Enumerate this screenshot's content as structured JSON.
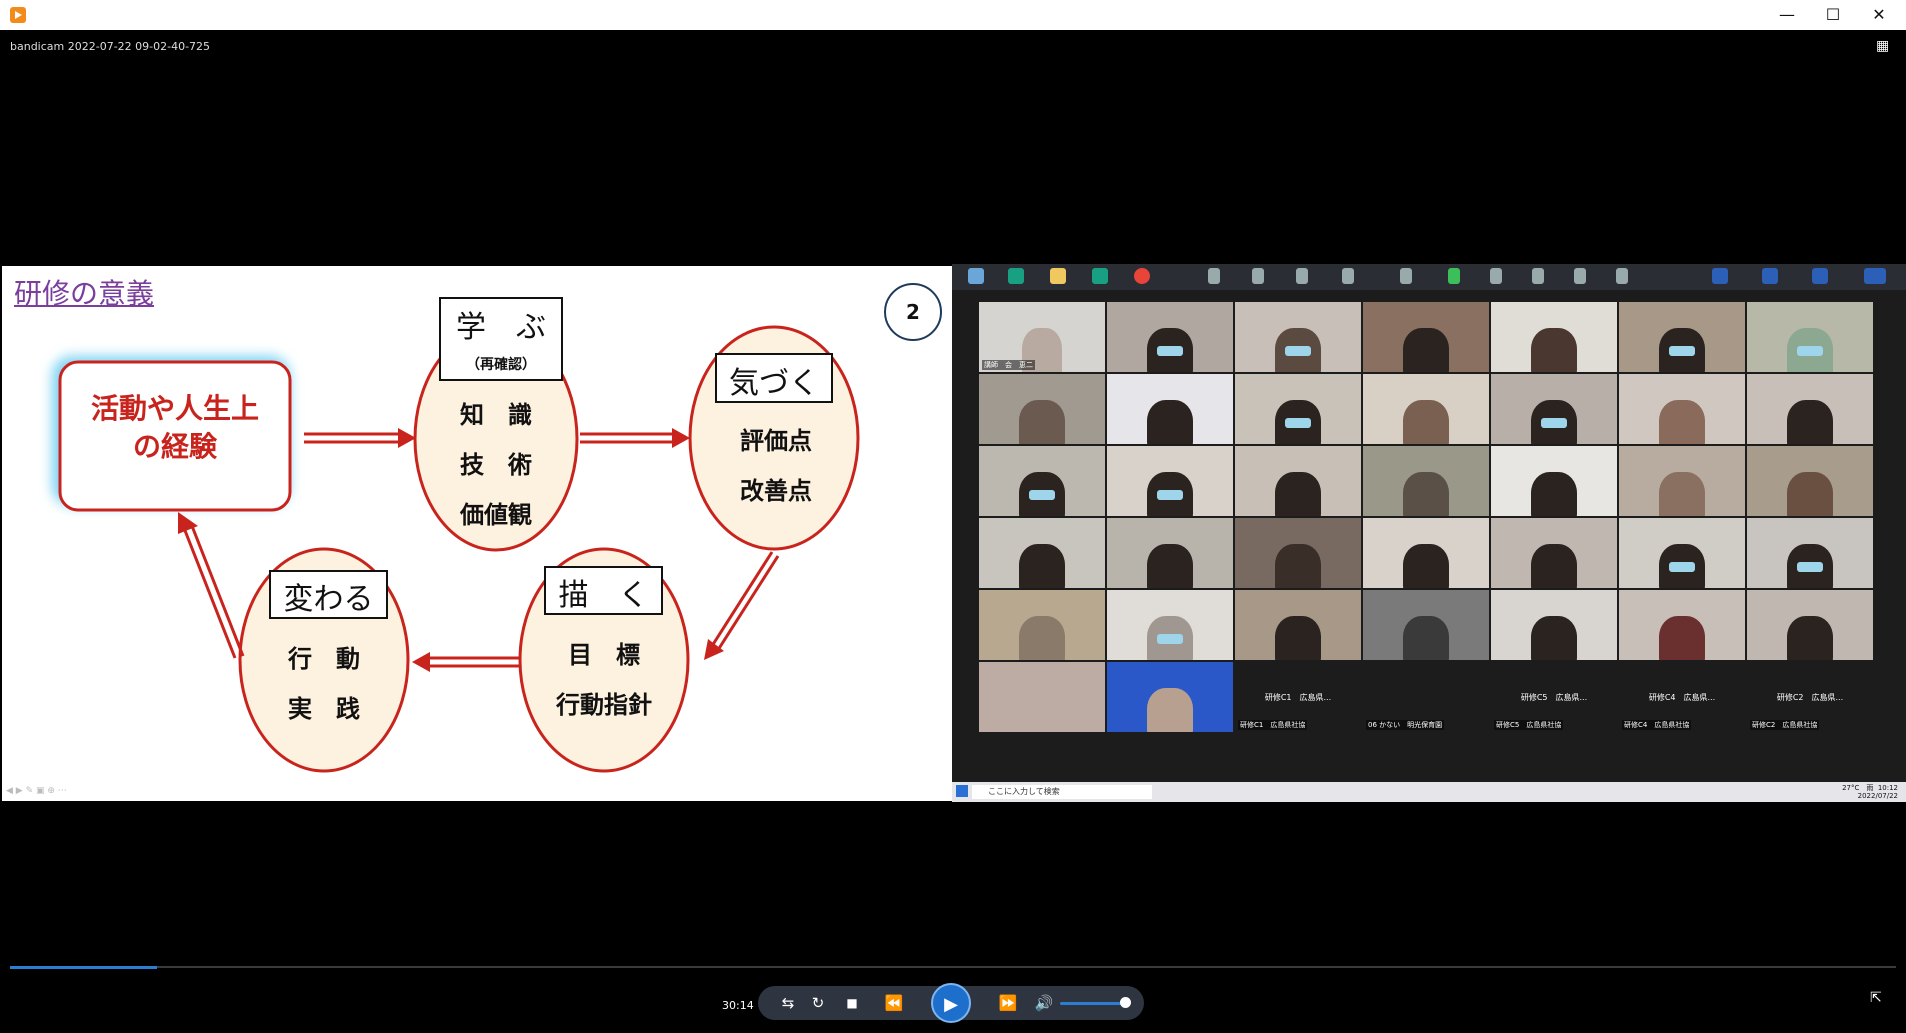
{
  "window": {
    "file_label": "bandicam 2022-07-22 09-02-40-725"
  },
  "slide": {
    "title": "研修の意義",
    "page_number": "2",
    "nodes": {
      "experience": "活動や人生上の経験",
      "experience_line1": "活動や人生上",
      "experience_line2": "の経験",
      "learn_label": "学　ぶ",
      "learn_sub": "（再確認）",
      "learn_items": [
        "知　識",
        "技　術",
        "価値観"
      ],
      "notice_label": "気づく",
      "notice_items": [
        "評価点",
        "改善点"
      ],
      "draw_label": "描　く",
      "draw_items": [
        "目　標",
        "行動指針"
      ],
      "change_label": "変わる",
      "change_items": [
        "行　動",
        "実　践"
      ]
    }
  },
  "zoom": {
    "tiles": [
      {
        "name": "講師　会　恵二"
      },
      {
        "name": ""
      },
      {
        "name": ""
      },
      {
        "name": ""
      },
      {
        "name": ""
      },
      {
        "name": ""
      },
      {
        "name": ""
      },
      {
        "name": ""
      },
      {
        "name": ""
      },
      {
        "name": ""
      },
      {
        "name": ""
      },
      {
        "name": ""
      },
      {
        "name": ""
      },
      {
        "name": ""
      },
      {
        "name": ""
      },
      {
        "name": ""
      },
      {
        "name": ""
      },
      {
        "name": ""
      },
      {
        "name": ""
      },
      {
        "name": ""
      },
      {
        "name": ""
      },
      {
        "name": ""
      },
      {
        "name": ""
      },
      {
        "name": ""
      },
      {
        "name": ""
      },
      {
        "name": ""
      },
      {
        "name": ""
      },
      {
        "name": ""
      },
      {
        "name": ""
      },
      {
        "name": ""
      },
      {
        "name": ""
      },
      {
        "name": ""
      },
      {
        "name": ""
      },
      {
        "name": ""
      },
      {
        "name": ""
      }
    ],
    "bottom_row": [
      {
        "label": "",
        "name": ""
      },
      {
        "label": "",
        "name": ""
      },
      {
        "label": "研修C1　広島県...",
        "name": "研修C1　広島県社協"
      },
      {
        "label": "",
        "name": "06 かない　明光保育園"
      },
      {
        "label": "研修C5　広島県...",
        "name": "研修C5　広島県社協"
      },
      {
        "label": "研修C4　広島県...",
        "name": "研修C4　広島県社協"
      },
      {
        "label": "研修C2　広島県...",
        "name": "研修C2　広島県社協"
      }
    ],
    "taskbar_search": "ここに入力して検索",
    "temperature": "27°C　雨",
    "clock_time": "10:12",
    "clock_date": "2022/07/22"
  },
  "player": {
    "time": "30:14",
    "progress": 0.078,
    "volume": 0.9
  },
  "colors": {
    "accent": "#2a7fd4",
    "slide_red": "#c8241d",
    "ellipse_fill": "#fdf1df"
  }
}
